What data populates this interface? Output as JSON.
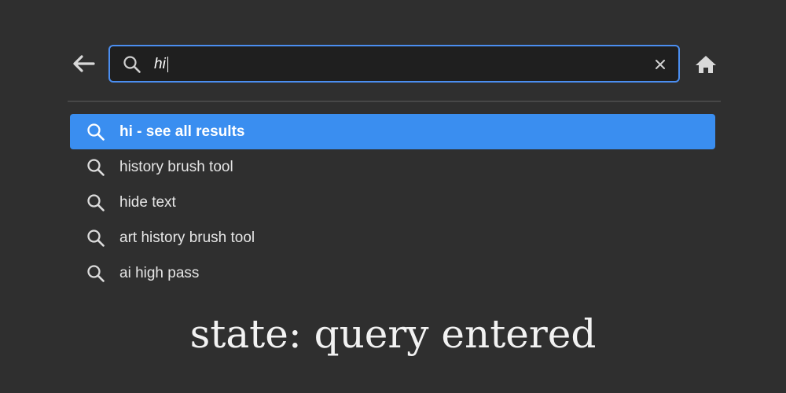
{
  "colors": {
    "background": "#2f2f2f",
    "search_border": "#4b8ef0",
    "selected_row": "#3a8ef0",
    "text": "#e6e6e6"
  },
  "header": {
    "back_icon": "arrow-left-icon",
    "home_icon": "home-icon"
  },
  "search": {
    "icon": "search-icon",
    "value": "hi",
    "clear_icon": "close-icon"
  },
  "suggestions": [
    {
      "label": "hi - see all results",
      "icon": "search-icon",
      "selected": true
    },
    {
      "label": "history brush tool",
      "icon": "search-icon",
      "selected": false
    },
    {
      "label": "hide text",
      "icon": "search-icon",
      "selected": false
    },
    {
      "label": "art history brush tool",
      "icon": "search-icon",
      "selected": false
    },
    {
      "label": "ai high pass",
      "icon": "search-icon",
      "selected": false
    }
  ],
  "caption": "state: query entered"
}
